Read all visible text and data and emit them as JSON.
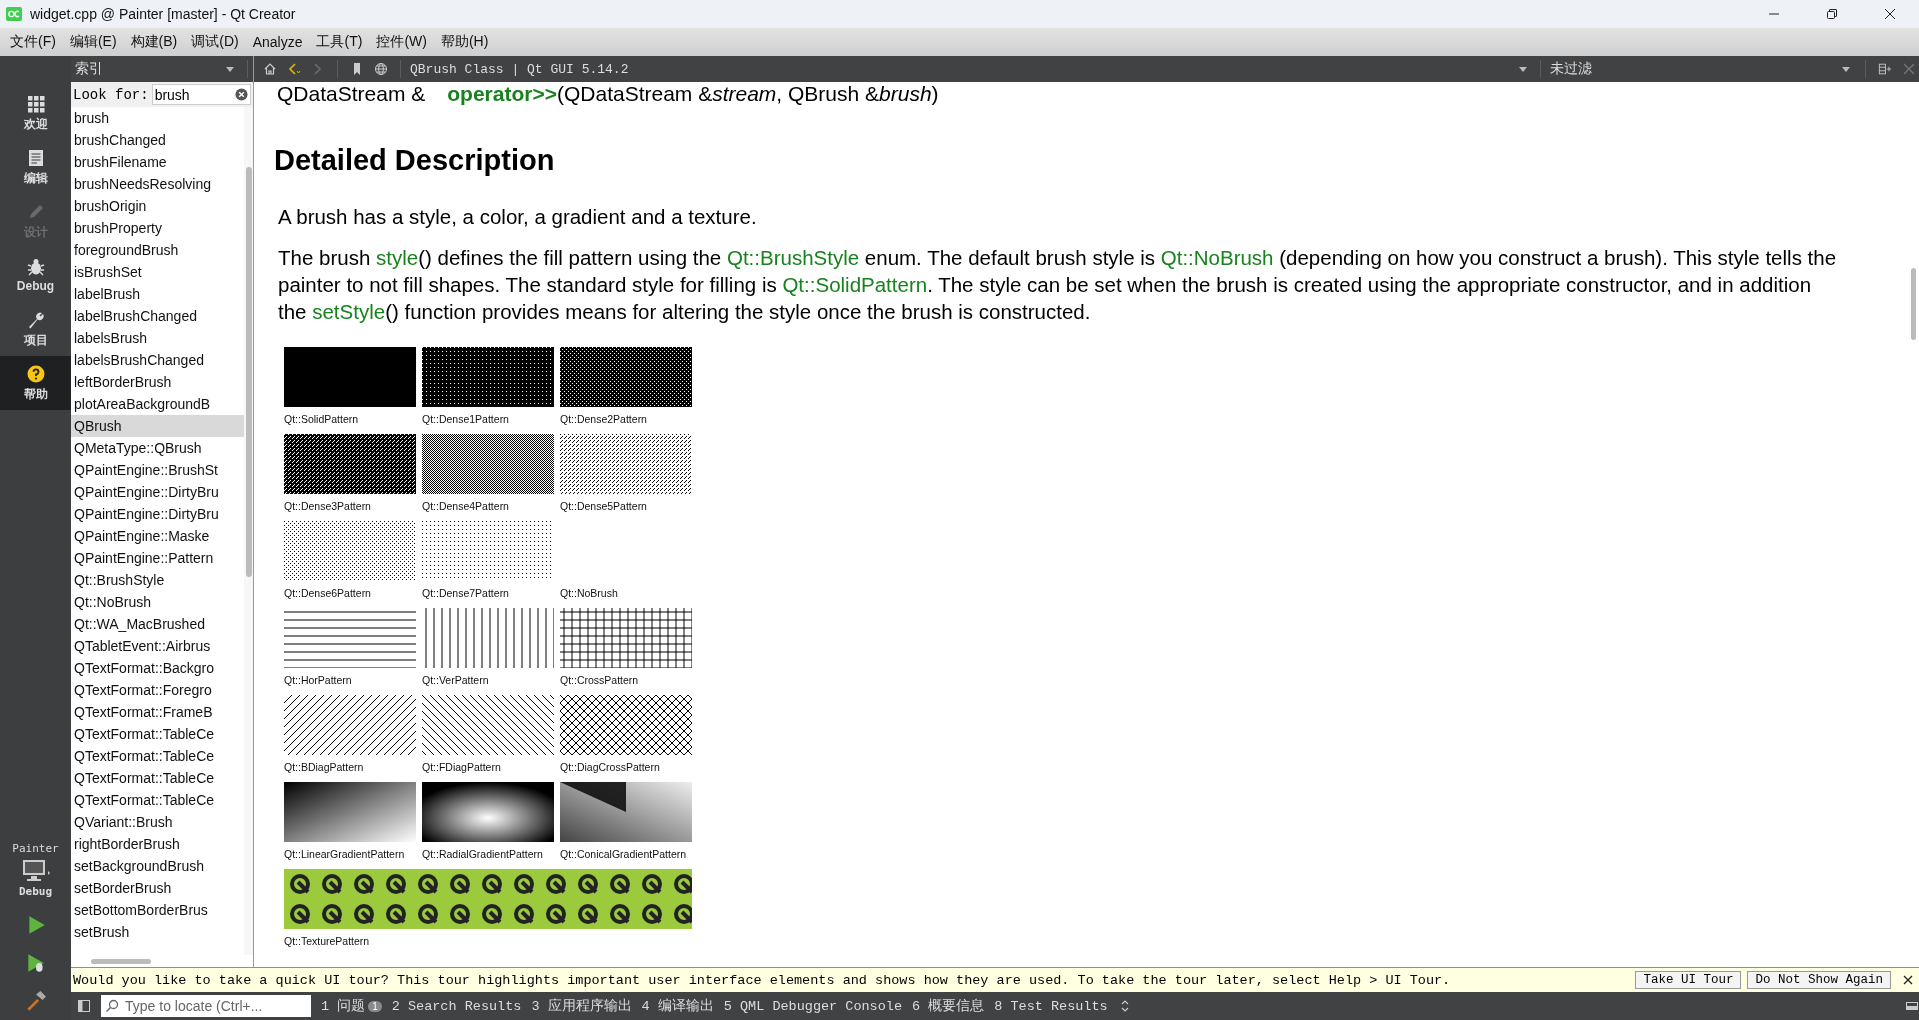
{
  "window": {
    "title": "widget.cpp @ Painter [master] - Qt Creator"
  },
  "menu": [
    "文件(F)",
    "编辑(E)",
    "构建(B)",
    "调试(D)",
    "Analyze",
    "工具(T)",
    "控件(W)",
    "帮助(H)"
  ],
  "modes": [
    {
      "label": "欢迎",
      "kind": "welcome",
      "selected": false,
      "disabled": false
    },
    {
      "label": "编辑",
      "kind": "edit",
      "selected": false,
      "disabled": false
    },
    {
      "label": "设计",
      "kind": "design",
      "selected": false,
      "disabled": true
    },
    {
      "label": "Debug",
      "kind": "debug",
      "selected": false,
      "disabled": false
    },
    {
      "label": "项目",
      "kind": "projects",
      "selected": false,
      "disabled": false
    },
    {
      "label": "帮助",
      "kind": "help",
      "selected": true,
      "disabled": false
    }
  ],
  "run_target": {
    "project": "Painter",
    "config": "Debug"
  },
  "index_panel": {
    "title": "索引",
    "look_for_label": "Look for:",
    "search_value": "brush",
    "items": [
      {
        "label": "brush",
        "selected": false
      },
      {
        "label": "brushChanged",
        "selected": false
      },
      {
        "label": "brushFilename",
        "selected": false
      },
      {
        "label": "brushNeedsResolving",
        "selected": false
      },
      {
        "label": "brushOrigin",
        "selected": false
      },
      {
        "label": "brushProperty",
        "selected": false
      },
      {
        "label": "foregroundBrush",
        "selected": false
      },
      {
        "label": "isBrushSet",
        "selected": false
      },
      {
        "label": "labelBrush",
        "selected": false
      },
      {
        "label": "labelBrushChanged",
        "selected": false
      },
      {
        "label": "labelsBrush",
        "selected": false
      },
      {
        "label": "labelsBrushChanged",
        "selected": false
      },
      {
        "label": "leftBorderBrush",
        "selected": false
      },
      {
        "label": "plotAreaBackgroundB",
        "selected": false
      },
      {
        "label": "QBrush",
        "selected": true
      },
      {
        "label": "QMetaType::QBrush",
        "selected": false
      },
      {
        "label": "QPaintEngine::BrushSt",
        "selected": false
      },
      {
        "label": "QPaintEngine::DirtyBru",
        "selected": false
      },
      {
        "label": "QPaintEngine::DirtyBru",
        "selected": false
      },
      {
        "label": "QPaintEngine::Maske",
        "selected": false
      },
      {
        "label": "QPaintEngine::Pattern",
        "selected": false
      },
      {
        "label": "Qt::BrushStyle",
        "selected": false
      },
      {
        "label": "Qt::NoBrush",
        "selected": false
      },
      {
        "label": "Qt::WA_MacBrushed",
        "selected": false
      },
      {
        "label": "QTabletEvent::Airbrus",
        "selected": false
      },
      {
        "label": "QTextFormat::Backgro",
        "selected": false
      },
      {
        "label": "QTextFormat::Foregro",
        "selected": false
      },
      {
        "label": "QTextFormat::FrameB",
        "selected": false
      },
      {
        "label": "QTextFormat::TableCe",
        "selected": false
      },
      {
        "label": "QTextFormat::TableCe",
        "selected": false
      },
      {
        "label": "QTextFormat::TableCe",
        "selected": false
      },
      {
        "label": "QTextFormat::TableCe",
        "selected": false
      },
      {
        "label": "QVariant::Brush",
        "selected": false
      },
      {
        "label": "rightBorderBrush",
        "selected": false
      },
      {
        "label": "setBackgroundBrush",
        "selected": false
      },
      {
        "label": "setBorderBrush",
        "selected": false
      },
      {
        "label": "setBottomBorderBrus",
        "selected": false
      },
      {
        "label": "setBrush",
        "selected": false
      }
    ]
  },
  "help_toolbar": {
    "document": "QBrush Class | Qt GUI 5.14.2",
    "filter": "未过滤"
  },
  "document": {
    "signature": {
      "return_type": "QDataStream &",
      "name": "operator>>",
      "args": "(QDataStream &*stream*, QBrush &*brush*)"
    },
    "heading": "Detailed Description",
    "paragraphs": [
      [
        {
          "kind": "text",
          "text": "A brush has a style, a color, a gradient and a texture."
        }
      ],
      [
        {
          "kind": "text",
          "text": "The brush "
        },
        {
          "kind": "link",
          "text": "style"
        },
        {
          "kind": "text",
          "text": "() defines the fill pattern using the "
        },
        {
          "kind": "link",
          "text": "Qt::BrushStyle"
        },
        {
          "kind": "text",
          "text": " enum. The default brush style is "
        },
        {
          "kind": "link",
          "text": "Qt::NoBrush"
        },
        {
          "kind": "text",
          "text": " (depending on how you construct a brush). This style tells the painter to not fill shapes. The standard style for filling is "
        },
        {
          "kind": "link",
          "text": "Qt::SolidPattern"
        },
        {
          "kind": "text",
          "text": ". The style can be set when the brush is created using the appropriate constructor, and in addition the "
        },
        {
          "kind": "link",
          "text": "setStyle"
        },
        {
          "kind": "text",
          "text": "() function provides means for altering the style once the brush is constructed."
        }
      ]
    ],
    "patterns": [
      {
        "kind": "solid",
        "label": "Qt::SolidPattern"
      },
      {
        "kind": "dense1",
        "label": "Qt::Dense1Pattern"
      },
      {
        "kind": "dense2",
        "label": "Qt::Dense2Pattern"
      },
      {
        "kind": "dense3",
        "label": "Qt::Dense3Pattern"
      },
      {
        "kind": "dense4",
        "label": "Qt::Dense4Pattern"
      },
      {
        "kind": "dense5",
        "label": "Qt::Dense5Pattern"
      },
      {
        "kind": "dense6",
        "label": "Qt::Dense6Pattern"
      },
      {
        "kind": "dense7",
        "label": "Qt::Dense7Pattern"
      },
      {
        "kind": "none",
        "label": "Qt::NoBrush"
      },
      {
        "kind": "hor",
        "label": "Qt::HorPattern"
      },
      {
        "kind": "ver",
        "label": "Qt::VerPattern"
      },
      {
        "kind": "cross",
        "label": "Qt::CrossPattern"
      },
      {
        "kind": "bdiag",
        "label": "Qt::BDiagPattern"
      },
      {
        "kind": "fdiag",
        "label": "Qt::FDiagPattern"
      },
      {
        "kind": "diagcross",
        "label": "Qt::DiagCrossPattern"
      },
      {
        "kind": "linear",
        "label": "Qt::LinearGradientPattern"
      },
      {
        "kind": "radial",
        "label": "Qt::RadialGradientPattern"
      },
      {
        "kind": "conical",
        "label": "Qt::ConicalGradientPattern"
      },
      {
        "kind": "texture",
        "label": "Qt::TexturePattern"
      }
    ]
  },
  "tour_bar": {
    "message": "Would you like to take a quick UI tour? This tour highlights important user interface elements and shows how they are used. To take the tour later, select Help > UI Tour.",
    "buttons": [
      "Take UI Tour",
      "Do Not Show Again"
    ]
  },
  "status_bar": {
    "locator_placeholder": "Type to locate (Ctrl+...",
    "panes": [
      {
        "label": "1 问题",
        "badge": "1"
      },
      {
        "label": "2 Search Results"
      },
      {
        "label": "3 应用程序输出"
      },
      {
        "label": "4 编译输出"
      },
      {
        "label": "5 QML Debugger Console"
      },
      {
        "label": "6 概要信息"
      },
      {
        "label": "8 Test Results"
      }
    ]
  }
}
